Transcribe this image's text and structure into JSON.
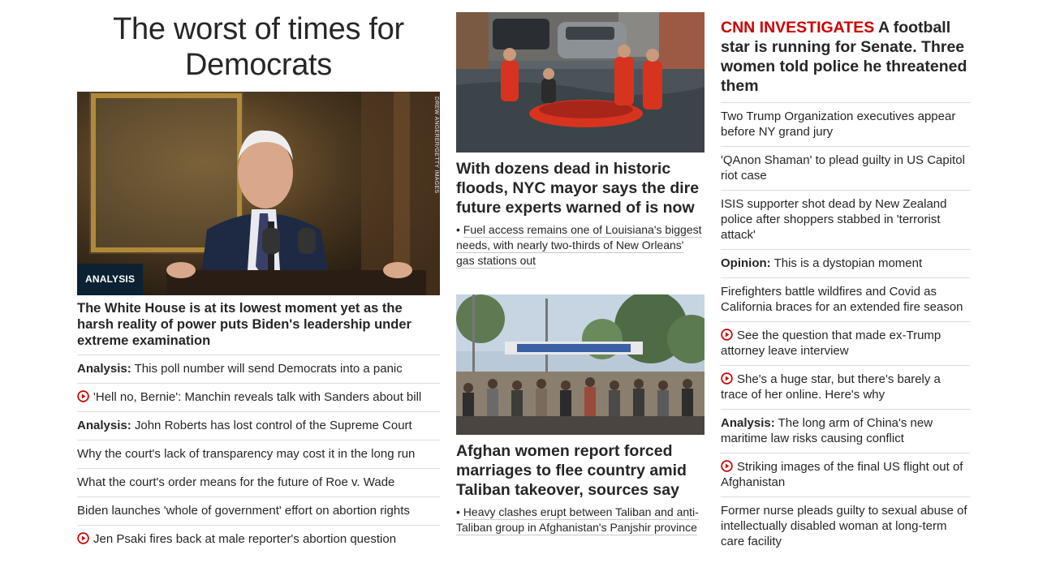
{
  "left": {
    "hero_title": "The worst of times for Democrats",
    "hero_badge": "ANALYSIS",
    "photo_credit": "DREW ANGERER/GETTY IMAGES",
    "hero_headline": "The White House is at its lowest moment yet as the harsh reality of power puts Biden's leadership under extreme examination",
    "stories": [
      {
        "prefix": "Analysis:",
        "video": false,
        "text": "This poll number will send Democrats into a panic"
      },
      {
        "prefix": "",
        "video": true,
        "text": "'Hell no, Bernie': Manchin reveals talk with Sanders about bill"
      },
      {
        "prefix": "Analysis:",
        "video": false,
        "text": "John Roberts has lost control of the Supreme Court"
      },
      {
        "prefix": "",
        "video": false,
        "text": "Why the court's lack of transparency may cost it in the long run"
      },
      {
        "prefix": "",
        "video": false,
        "text": "What the court's order means for the future of Roe v. Wade"
      },
      {
        "prefix": "",
        "video": false,
        "text": "Biden launches 'whole of government' effort on abortion rights"
      },
      {
        "prefix": "",
        "video": true,
        "text": "Jen Psaki fires back at male reporter's abortion question"
      }
    ]
  },
  "middle": {
    "story1": {
      "headline": "With dozens dead in historic floods, NYC mayor says the dire future experts warned of is now",
      "bullet": "Fuel access remains one of Louisiana's biggest needs, with nearly two-thirds of New Orleans' gas stations out"
    },
    "story2": {
      "headline": "Afghan women report forced marriages to flee country amid Taliban takeover, sources say",
      "bullet": "Heavy clashes erupt between Taliban and anti-Taliban group in Afghanistan's Panjshir province"
    }
  },
  "right": {
    "kicker": "CNN INVESTIGATES",
    "headline": "A football star is running for Senate. Three women told police he threatened them",
    "stories": [
      {
        "prefix": "",
        "video": false,
        "text": "Two Trump Organization executives appear before NY grand jury"
      },
      {
        "prefix": "",
        "video": false,
        "text": "'QAnon Shaman' to plead guilty in US Capitol riot case"
      },
      {
        "prefix": "",
        "video": false,
        "text": "ISIS supporter shot dead by New Zealand police after shoppers stabbed in 'terrorist attack'"
      },
      {
        "prefix": "Opinion:",
        "video": false,
        "text": "This is a dystopian moment"
      },
      {
        "prefix": "",
        "video": false,
        "text": "Firefighters battle wildfires and Covid as California braces for an extended fire season"
      },
      {
        "prefix": "",
        "video": true,
        "text": "See the question that made ex-Trump attorney leave interview"
      },
      {
        "prefix": "",
        "video": true,
        "text": "She's a huge star, but there's barely a trace of her online. Here's why"
      },
      {
        "prefix": "Analysis:",
        "video": false,
        "text": "The long arm of China's new maritime law risks causing conflict"
      },
      {
        "prefix": "",
        "video": true,
        "text": "Striking images of the final US flight out of Afghanistan"
      },
      {
        "prefix": "",
        "video": false,
        "text": "Former nurse pleads guilty to sexual abuse of intellectually disabled woman at long-term care facility"
      }
    ]
  },
  "icons": {
    "video": "play-circle-icon"
  },
  "colors": {
    "accent": "#cc0000",
    "badge_bg": "#0c2233",
    "text": "#262626",
    "divider": "#dcdcdc"
  }
}
